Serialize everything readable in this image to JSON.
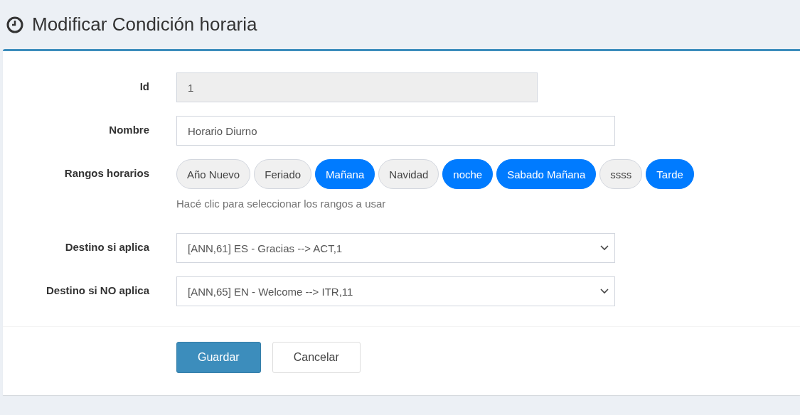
{
  "page": {
    "title": "Modificar Condición horaria"
  },
  "fields": [
    {
      "kind": "text",
      "label": "Id",
      "value": "1",
      "disabled": true
    },
    {
      "kind": "text",
      "label": "Nombre",
      "value": "Horario Diurno",
      "disabled": false
    },
    {
      "kind": "pills",
      "label": "Rangos horarios",
      "help": "Hacé clic para seleccionar los rangos a usar",
      "options": [
        {
          "label": "Año Nuevo",
          "selected": false
        },
        {
          "label": "Feriado",
          "selected": false
        },
        {
          "label": "Mañana",
          "selected": true
        },
        {
          "label": "Navidad",
          "selected": false
        },
        {
          "label": "noche",
          "selected": true
        },
        {
          "label": "Sabado Mañana",
          "selected": true
        },
        {
          "label": "ssss",
          "selected": false
        },
        {
          "label": "Tarde",
          "selected": true
        }
      ]
    },
    {
      "kind": "select",
      "label": "Destino si aplica",
      "value": "[ANN,61] ES - Gracias --> ACT,1"
    },
    {
      "kind": "select",
      "label": "Destino si NO aplica",
      "value": "[ANN,65] EN - Welcome --> ITR,11"
    }
  ],
  "buttons": [
    {
      "kind": "primary",
      "label": "Guardar"
    },
    {
      "kind": "default",
      "label": "Cancelar"
    }
  ]
}
